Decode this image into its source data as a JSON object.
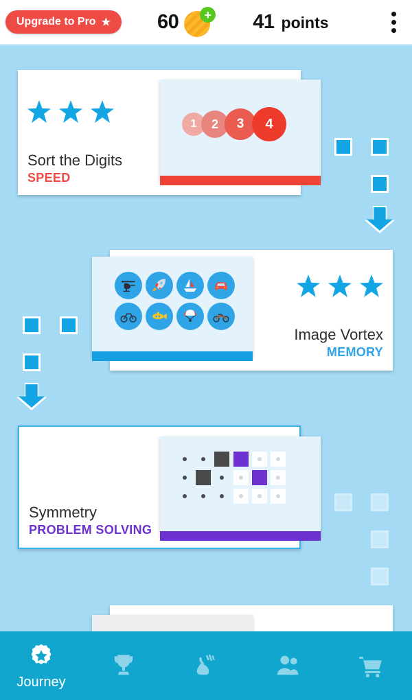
{
  "header": {
    "upgrade_label": "Upgrade to Pro",
    "upgrade_icon": "star-icon",
    "upgrade_color": "#ef4b45",
    "coin_count": "60",
    "coin_icon": "coin-icon",
    "coin_add_badge": "+",
    "points_count": "41",
    "points_label": "points",
    "overflow_icon": "kebab-menu-icon"
  },
  "journey": {
    "games": [
      {
        "title": "Sort the Digits",
        "category": "SPEED",
        "category_color": "#ef4b45",
        "accent_color": "#ee4236",
        "stars": 3,
        "selected": false,
        "thumb_type": "digits",
        "digits": [
          "1",
          "2",
          "3",
          "4"
        ]
      },
      {
        "title": "Image Vortex",
        "category": "MEMORY",
        "category_color": "#2fa5e8",
        "accent_color": "#169fe0",
        "stars": 3,
        "selected": false,
        "thumb_type": "icons",
        "icons": [
          "helicopter-icon",
          "rocket-icon",
          "sailboat-icon",
          "car-icon",
          "bicycle-icon",
          "submarine-icon",
          "parachute-icon",
          "motorcycle-icon"
        ]
      },
      {
        "title": "Symmetry",
        "category": "PROBLEM SOLVING",
        "category_color": "#6c31ce",
        "accent_color": "#6c31ce",
        "stars": 0,
        "selected": true,
        "thumb_type": "symmetry",
        "grid_left": [
          [
            "dot",
            "dot",
            "filled-dark"
          ],
          [
            "dot",
            "filled-dark",
            "dot"
          ],
          [
            "dot",
            "dot",
            "dot"
          ]
        ],
        "grid_right": [
          [
            "filled-purple",
            "blank",
            "blank"
          ],
          [
            "blank",
            "filled-purple",
            "blank"
          ],
          [
            "blank",
            "blank",
            "blank"
          ]
        ]
      }
    ],
    "path_nodes_label": "journey-path",
    "node_color": "#14a5e4",
    "node_dim_color": "#c7e8f8"
  },
  "bottom_nav": {
    "items": [
      {
        "label": "Journey",
        "icon": "journey-badge-icon",
        "active": true
      },
      {
        "label": "",
        "icon": "trophy-icon",
        "active": false
      },
      {
        "label": "",
        "icon": "workout-icon",
        "active": false
      },
      {
        "label": "",
        "icon": "friends-icon",
        "active": false
      },
      {
        "label": "",
        "icon": "cart-icon",
        "active": false
      }
    ],
    "background": "#10a6ce"
  },
  "background_color": "#a5daf5"
}
